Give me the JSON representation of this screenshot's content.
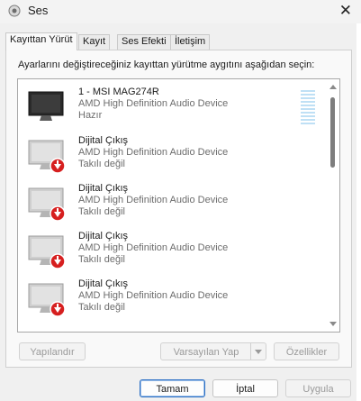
{
  "window": {
    "title": "Ses",
    "close_glyph": "✕",
    "app_icon": "speaker-icon"
  },
  "tabs": [
    {
      "label": "Kayıttan Yürüt",
      "active": true
    },
    {
      "label": "Kayıt",
      "active": false
    },
    {
      "label": "Ses Efekti",
      "active": false
    },
    {
      "label": "İletişim",
      "active": false
    }
  ],
  "instruction": "Ayarlarını değiştireceğiniz kayıttan yürütme aygıtını aşağıdan seçin:",
  "devices": [
    {
      "name": "1 - MSI MAG274R",
      "description": "AMD High Definition Audio Device",
      "status": "Hazır",
      "icon": "monitor-icon",
      "connected": true
    },
    {
      "name": "Dijital Çıkış",
      "description": "AMD High Definition Audio Device",
      "status": "Takılı değil",
      "icon": "monitor-icon",
      "connected": false
    },
    {
      "name": "Dijital Çıkış",
      "description": "AMD High Definition Audio Device",
      "status": "Takılı değil",
      "icon": "monitor-icon",
      "connected": false
    },
    {
      "name": "Dijital Çıkış",
      "description": "AMD High Definition Audio Device",
      "status": "Takılı değil",
      "icon": "monitor-icon",
      "connected": false
    },
    {
      "name": "Dijital Çıkış",
      "description": "AMD High Definition Audio Device",
      "status": "Takılı değil",
      "icon": "monitor-icon",
      "connected": false
    }
  ],
  "panel_buttons": {
    "configure": "Yapılandır",
    "set_default": "Varsayılan Yap",
    "properties": "Özellikler"
  },
  "dialog_buttons": {
    "ok": "Tamam",
    "cancel": "İptal",
    "apply": "Uygula"
  },
  "colors": {
    "accent": "#2b6fc4",
    "unplugged_badge": "#d61f1f",
    "level_meter": "#bfe0f5"
  }
}
